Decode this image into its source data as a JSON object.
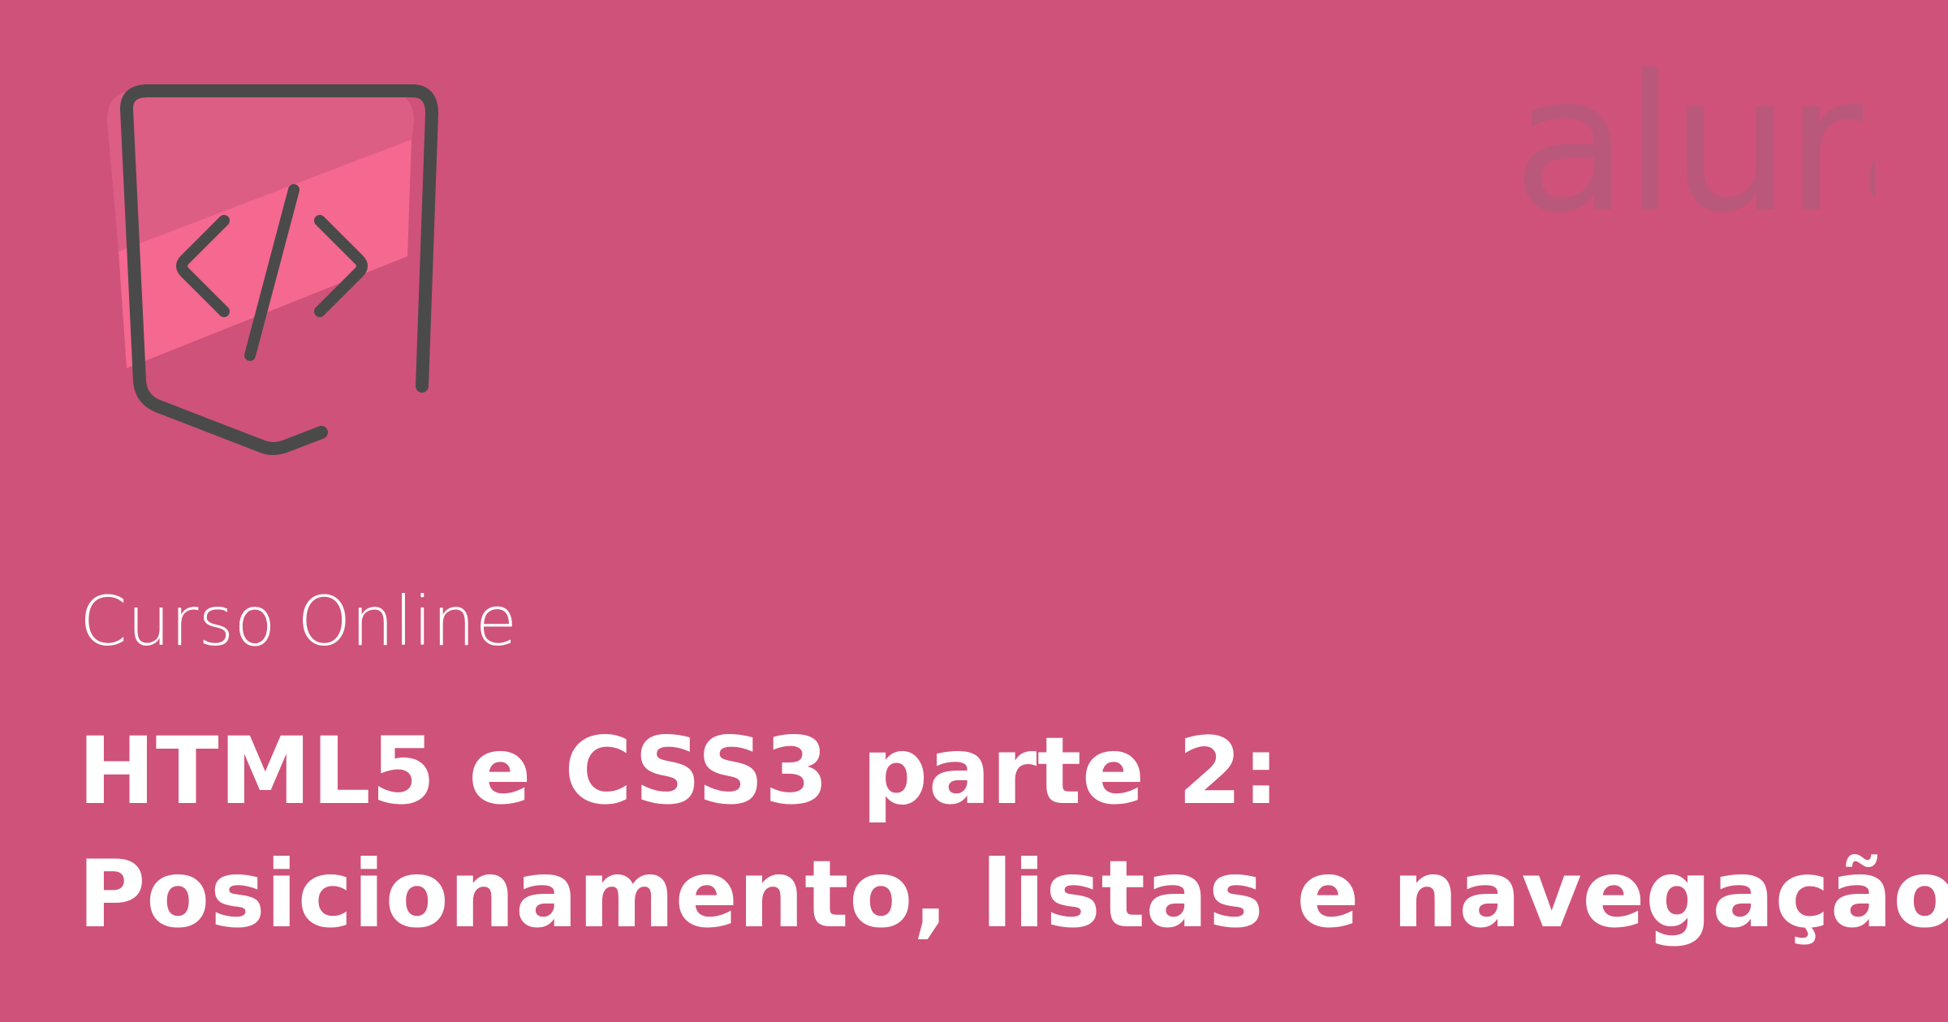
{
  "brand": {
    "logo_text": "alura",
    "logo_color": "#b9587a"
  },
  "icon": {
    "name": "html-code-shield-icon",
    "stroke_color": "#4a4a4a",
    "fill_light": "#dd5e84",
    "fill_band": "#f56890"
  },
  "course": {
    "label": "Curso Online",
    "title_line_1": "HTML5 e CSS3 parte 2:",
    "title_line_2": "Posicionamento, listas e navegação"
  },
  "colors": {
    "background": "#cf527a",
    "text": "#ffffff"
  }
}
